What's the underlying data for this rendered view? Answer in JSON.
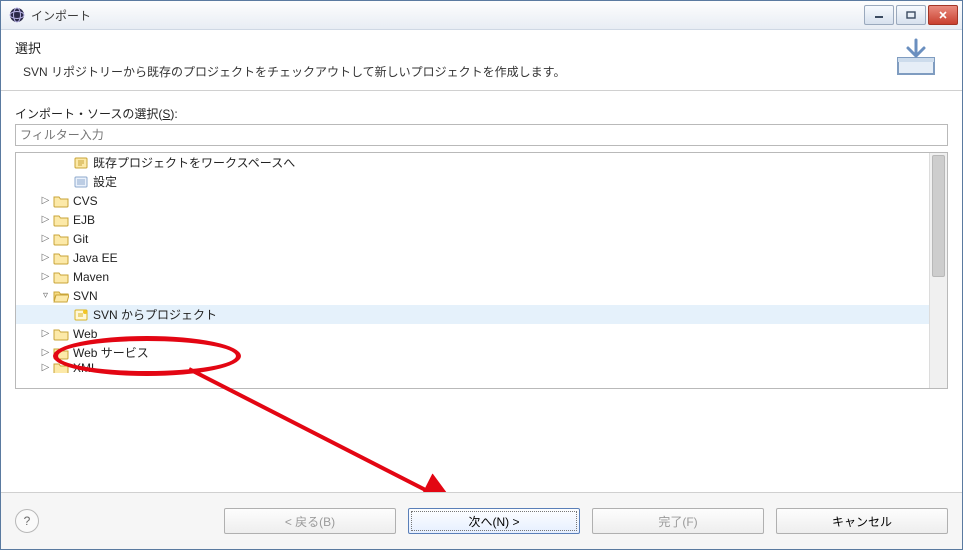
{
  "window": {
    "title": "インポート"
  },
  "header": {
    "title": "選択",
    "description": "SVN リポジトリーから既存のプロジェクトをチェックアウトして新しいプロジェクトを作成します。"
  },
  "source": {
    "label_pre": "インポート・ソースの選択(",
    "label_mnemonic": "S",
    "label_post": "):",
    "filter_placeholder": "フィルター入力"
  },
  "tree": {
    "items": [
      {
        "indent": 2,
        "twisty": "",
        "icon": "leaf-yellow",
        "label": "既存プロジェクトをワークスペースへ",
        "interact": true
      },
      {
        "indent": 2,
        "twisty": "",
        "icon": "settings",
        "label": "設定",
        "interact": true
      },
      {
        "indent": 1,
        "twisty": "▷",
        "icon": "folder",
        "label": "CVS",
        "interact": true
      },
      {
        "indent": 1,
        "twisty": "▷",
        "icon": "folder",
        "label": "EJB",
        "interact": true
      },
      {
        "indent": 1,
        "twisty": "▷",
        "icon": "folder",
        "label": "Git",
        "interact": true
      },
      {
        "indent": 1,
        "twisty": "▷",
        "icon": "folder",
        "label": "Java EE",
        "interact": true
      },
      {
        "indent": 1,
        "twisty": "▷",
        "icon": "folder",
        "label": "Maven",
        "interact": true
      },
      {
        "indent": 1,
        "twisty": "▿",
        "icon": "folder-open",
        "label": "SVN",
        "interact": true
      },
      {
        "indent": 2,
        "twisty": "",
        "icon": "leaf-wiz",
        "label": "SVN からプロジェクト",
        "interact": true,
        "selected": true
      },
      {
        "indent": 1,
        "twisty": "▷",
        "icon": "folder",
        "label": "Web",
        "interact": true
      },
      {
        "indent": 1,
        "twisty": "▷",
        "icon": "folder",
        "label": "Web サービス",
        "interact": true
      },
      {
        "indent": 1,
        "twisty": "▷",
        "icon": "folder",
        "label": "XML",
        "interact": true,
        "cut": true
      }
    ]
  },
  "buttons": {
    "back": "< 戻る(B)",
    "next": "次へ(N) >",
    "finish": "完了(F)",
    "cancel": "キャンセル"
  },
  "annotation": {
    "circle1_note": "highlight around 'SVN からプロジェクト'",
    "circle2_note": "highlight around '次へ(N) >' button",
    "arrow_note": "arrow from circle1 to circle2"
  }
}
